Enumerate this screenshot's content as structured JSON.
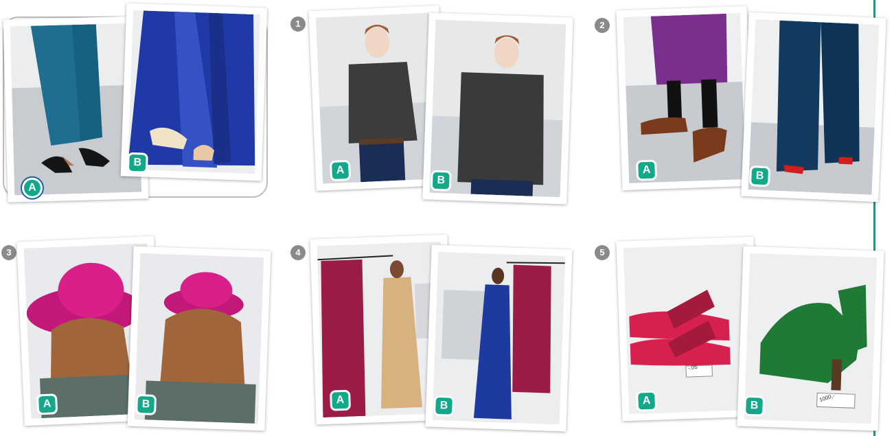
{
  "example": {
    "label_a": "A",
    "label_b": "B"
  },
  "items": [
    {
      "number": "1",
      "label_a": "A",
      "label_b": "B"
    },
    {
      "number": "2",
      "label_a": "A",
      "label_b": "B"
    },
    {
      "number": "3",
      "label_a": "A",
      "label_b": "B"
    },
    {
      "number": "4",
      "label_a": "A",
      "label_b": "B"
    },
    {
      "number": "5",
      "label_a": "A",
      "label_b": "B",
      "price_tag_a": "-,05",
      "price_tag_b": "1000,-"
    }
  ],
  "colors": {
    "badge": "#11a98a",
    "rule": "#2f8f80",
    "number_circle": "#8a8a8a"
  }
}
